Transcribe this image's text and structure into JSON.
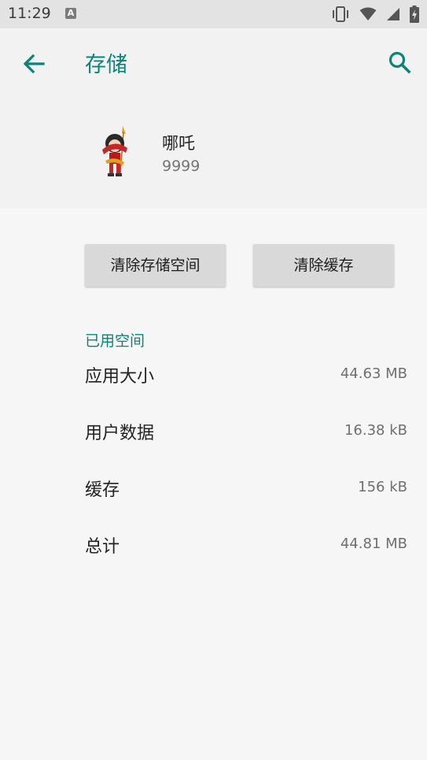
{
  "status_bar": {
    "time": "11:29",
    "notification_icon": "A",
    "icons": [
      "vibrate-icon",
      "wifi-icon",
      "signal-icon",
      "battery-charging-icon"
    ]
  },
  "app_bar": {
    "title": "存储",
    "back_icon": "arrow-left-icon",
    "search_icon": "search-icon",
    "accent_color": "#0b8478"
  },
  "app_info": {
    "name": "哪吒",
    "version": "9999",
    "icon": "nezha-app-icon"
  },
  "actions": {
    "clear_storage_label": "清除存储空间",
    "clear_cache_label": "清除缓存"
  },
  "storage": {
    "section_title": "已用空间",
    "rows": [
      {
        "label": "应用大小",
        "value": "44.63 MB"
      },
      {
        "label": "用户数据",
        "value": "16.38 kB"
      },
      {
        "label": "缓存",
        "value": "156 kB"
      },
      {
        "label": "总计",
        "value": "44.81 MB"
      }
    ]
  }
}
